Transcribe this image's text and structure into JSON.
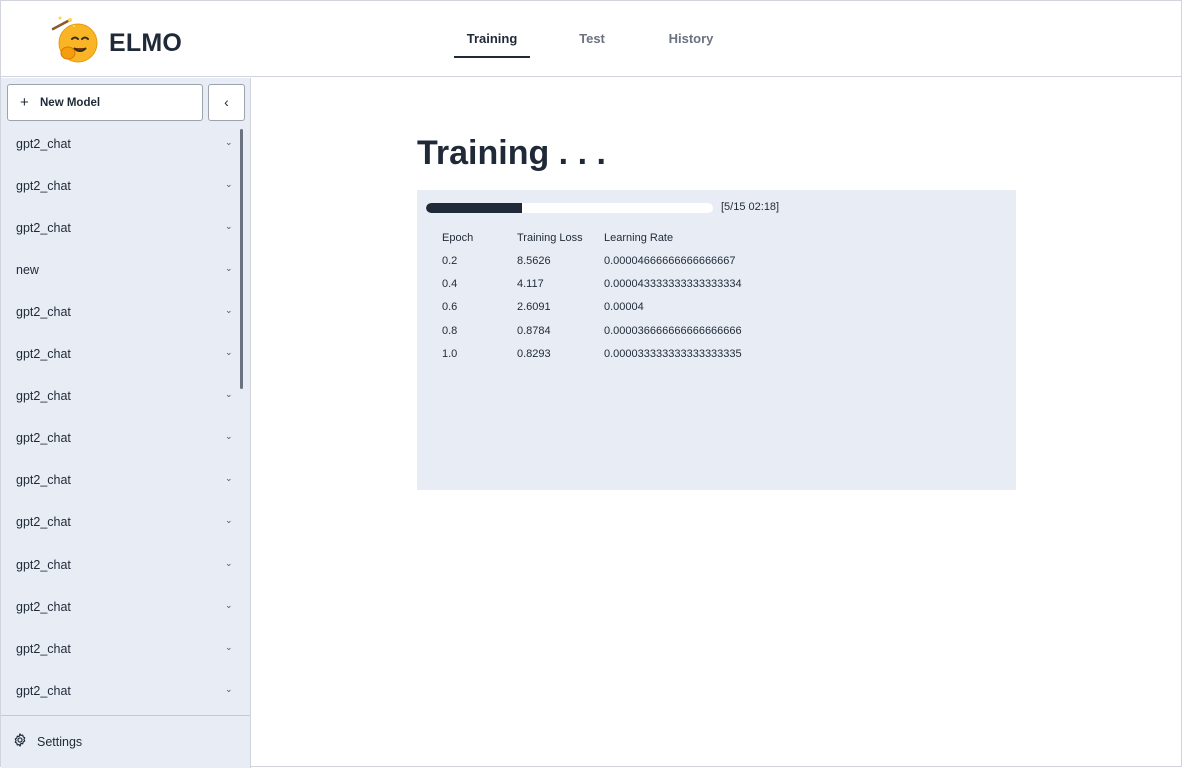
{
  "app": {
    "brand": "ELMO"
  },
  "tabs": [
    {
      "label": "Training",
      "active": true
    },
    {
      "label": "Test",
      "active": false
    },
    {
      "label": "History",
      "active": false
    }
  ],
  "sidebar": {
    "new_model_label": "New Model",
    "collapse_icon": "chevron-left-icon",
    "models": [
      {
        "label": "gpt2_chat"
      },
      {
        "label": "gpt2_chat"
      },
      {
        "label": "gpt2_chat"
      },
      {
        "label": "new"
      },
      {
        "label": "gpt2_chat"
      },
      {
        "label": "gpt2_chat"
      },
      {
        "label": "gpt2_chat"
      },
      {
        "label": "gpt2_chat"
      },
      {
        "label": "gpt2_chat"
      },
      {
        "label": "gpt2_chat"
      },
      {
        "label": "gpt2_chat"
      },
      {
        "label": "gpt2_chat"
      },
      {
        "label": "gpt2_chat"
      },
      {
        "label": "gpt2_chat"
      }
    ],
    "settings_label": "Settings"
  },
  "main": {
    "title": "Training . . .",
    "progress": {
      "current": 5,
      "total": 15,
      "text": "[5/15 02:18]"
    },
    "table": {
      "headers": [
        "Epoch",
        "Training Loss",
        "Learning Rate"
      ],
      "rows": [
        [
          "0.2",
          "8.5626",
          "0.00004666666666666667"
        ],
        [
          "0.4",
          "4.117",
          "0.000043333333333333334"
        ],
        [
          "0.6",
          "2.6091",
          "0.00004"
        ],
        [
          "0.8",
          "0.8784",
          "0.000036666666666666666"
        ],
        [
          "1.0",
          "0.8293",
          "0.000033333333333333335"
        ]
      ]
    }
  },
  "colors": {
    "sidebar_bg": "#e8edf5",
    "text": "#1f2937",
    "progress_fill": "#1f2937"
  }
}
